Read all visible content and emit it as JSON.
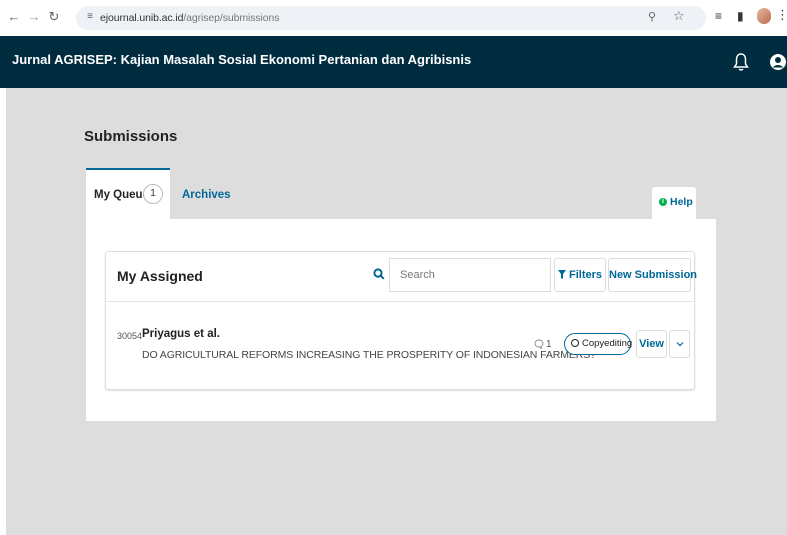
{
  "browser": {
    "url_domain": "ejournal.unib.ac.id",
    "url_path": "/agrisep/submissions",
    "back_icon": "arrow-left-icon",
    "forward_icon": "arrow-right-icon",
    "reload_icon": "reload-icon",
    "zoom_icon": "zoom-icon",
    "bookmark_icon": "star-icon",
    "menu_icon": "more-vert-icon"
  },
  "header": {
    "title": "Jurnal AGRISEP: Kajian Masalah Sosial Ekonomi Pertanian dan Agribisnis",
    "background": "#002c40",
    "notifications_icon": "bell-icon",
    "user_icon": "user-icon"
  },
  "page": {
    "title": "Submissions"
  },
  "tabs": [
    {
      "label": "My Queue",
      "count": "1",
      "active": true
    },
    {
      "label": "Archives",
      "active": false
    }
  ],
  "help": {
    "label": "Help",
    "icon": "info-icon"
  },
  "list": {
    "title": "My Assigned",
    "search_placeholder": "Search",
    "filters_label": "Filters",
    "new_submission_label": "New Submission"
  },
  "submissions": [
    {
      "id": "30054",
      "author": "Priyagus et al.",
      "title": "DO AGRICULTURAL REFORMS INCREASING THE PROSPERITY OF INDONESIAN FARMERS?",
      "comments": "1",
      "stage": "Copyediting",
      "view_label": "View"
    }
  ],
  "colors": {
    "accent": "#006798",
    "help_icon": "#00b24e",
    "page_bg": "#dddddd"
  }
}
